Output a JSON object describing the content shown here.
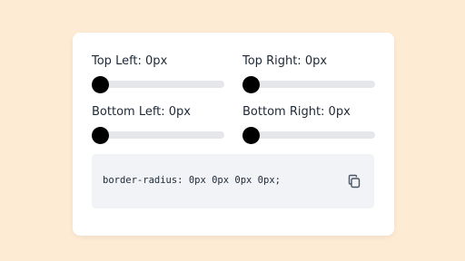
{
  "controls": [
    {
      "label": "Top Left: 0px",
      "value": 0
    },
    {
      "label": "Top Right: 0px",
      "value": 0
    },
    {
      "label": "Bottom Left: 0px",
      "value": 0
    },
    {
      "label": "Bottom Right: 0px",
      "value": 0
    }
  ],
  "slider": {
    "min": 0,
    "max": 100
  },
  "output": {
    "code": "border-radius: 0px 0px 0px 0px;"
  },
  "icons": {
    "copy": "copy-icon"
  },
  "colors": {
    "background": "#fdebd4",
    "card": "#ffffff",
    "track": "#e5e7eb",
    "thumb": "#000000",
    "code_bg": "#f1f3f6"
  }
}
